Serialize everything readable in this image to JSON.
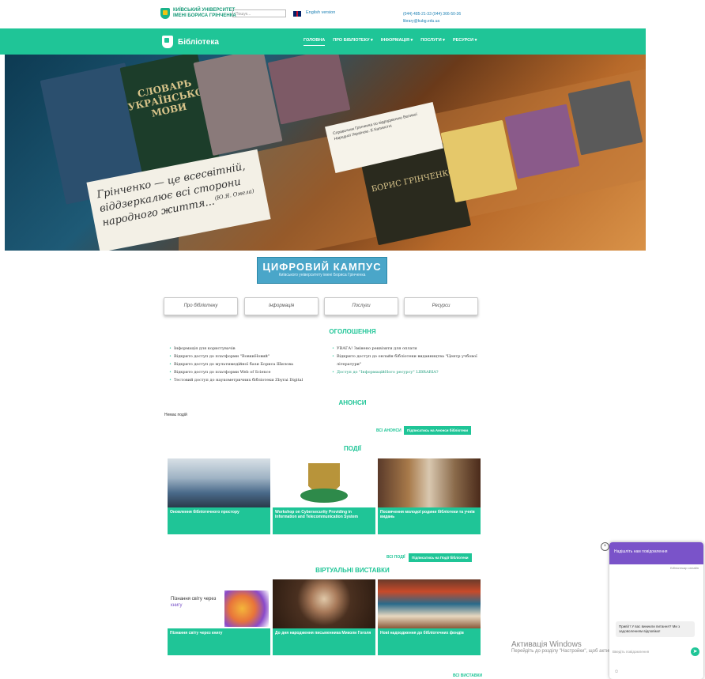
{
  "header": {
    "logo_text": "КИЇВСЬКИЙ УНІВЕРСИТЕТ ІМЕНІ БОРИСА ГРІНЧЕНКА",
    "search_placeholder": "Пошук...",
    "english_link": "English version",
    "phone": "(044) 485-21-33   (044) 366-50-36",
    "email": "library@kubg.edu.ua"
  },
  "nav": {
    "brand": "Бібліотека",
    "items": [
      {
        "label": "ГОЛОВНА"
      },
      {
        "label": "ПРО БІБЛІОТЕКУ ▾"
      },
      {
        "label": "ІНФОРМАЦІЯ ▾"
      },
      {
        "label": "ПОСЛУГИ ▾"
      },
      {
        "label": "РЕСУРСИ ▾"
      }
    ]
  },
  "hero": {
    "quote": "Грінченко — це всесвітній, віддзеркалює всі сторони народного життя...",
    "quote_author": "(Ю.Я. Омела)",
    "plaque": "Справочник Грінченка по відродженню Великої Народної Україною. Е.Капнистні",
    "book_1": "СЛОВАРЬ УКРАЇНСЬКОЇ МОВИ",
    "book_2": "БОРИС ГРІНЧЕНКО"
  },
  "campus": {
    "title": "ЦИФРОВИЙ КАМПУС",
    "subtitle": "Київського університету імені Бориса Грінченка"
  },
  "quick_links": [
    "Про бібліотеку",
    "Інформація",
    "Послуги",
    "Ресурси"
  ],
  "announcements": {
    "title": "ОГОЛОШЕННЯ",
    "left": [
      "Інформація для користувачів",
      "Відкрито доступ до платформи \"ВовкиНовий\"",
      "Відкрито доступ до мультимедійної бази Бориса Шилова",
      "Відкрито доступ до платформи Web of Science",
      "Тестовий доступ до наукометричних бібліотеки Zbyrai Digital"
    ],
    "right": [
      "УВАГА! Змінено реквізити для оплати",
      "Відкрито доступ до онлайн бібліотеки видавництва \"Центр учбової літератури\"",
      "Доступ до \"ІнформаційНого ресурсу\" LIBRARIA?"
    ]
  },
  "previews": {
    "title": "АНОНСИ",
    "no_events": "Немає подій",
    "all_link": "ВСІ АНОНСИ",
    "subscribe": "Підписатись на Анонси бібліотеки"
  },
  "events": {
    "title": "ПОДІЇ",
    "cards": [
      {
        "caption": "Оновлення бібліотечного простору"
      },
      {
        "caption": "Workshop on Cybersecurity Providing in Information and Telecommunication System"
      },
      {
        "caption": "Посвячення молодої родини бібліотеки та учнів видань"
      }
    ],
    "all_link": "ВСІ ПОДІЇ",
    "subscribe": "Підписатись на Події бібліотеки"
  },
  "exhibitions": {
    "title": "ВІРТУАЛЬНІ ВИСТАВКИ",
    "cards": [
      {
        "caption": "Пізнання світу через книгу",
        "img_line1": "Пізнання світу через",
        "img_line2": "книгу"
      },
      {
        "caption": "До дня народження письменника Миколи Гоголя"
      },
      {
        "caption": "Нові надходження до бібліотечних фондів"
      }
    ],
    "all_link": "ВСІ ВИСТАВКИ"
  },
  "windows": {
    "title": "Активація Windows",
    "subtitle": "Перейдіть до розділу \"Настройки\", щоб активувати Windows."
  },
  "chat": {
    "header": "Надішліть нам повідомлення",
    "status": "Бібліотекар онлайн",
    "greeting": "Привіт! У вас виникли питання? Ми з задоволенням відповімо!",
    "input_placeholder": "Введіть повідомлення",
    "close": "×",
    "send": "➤",
    "footer_icon": "☺"
  }
}
